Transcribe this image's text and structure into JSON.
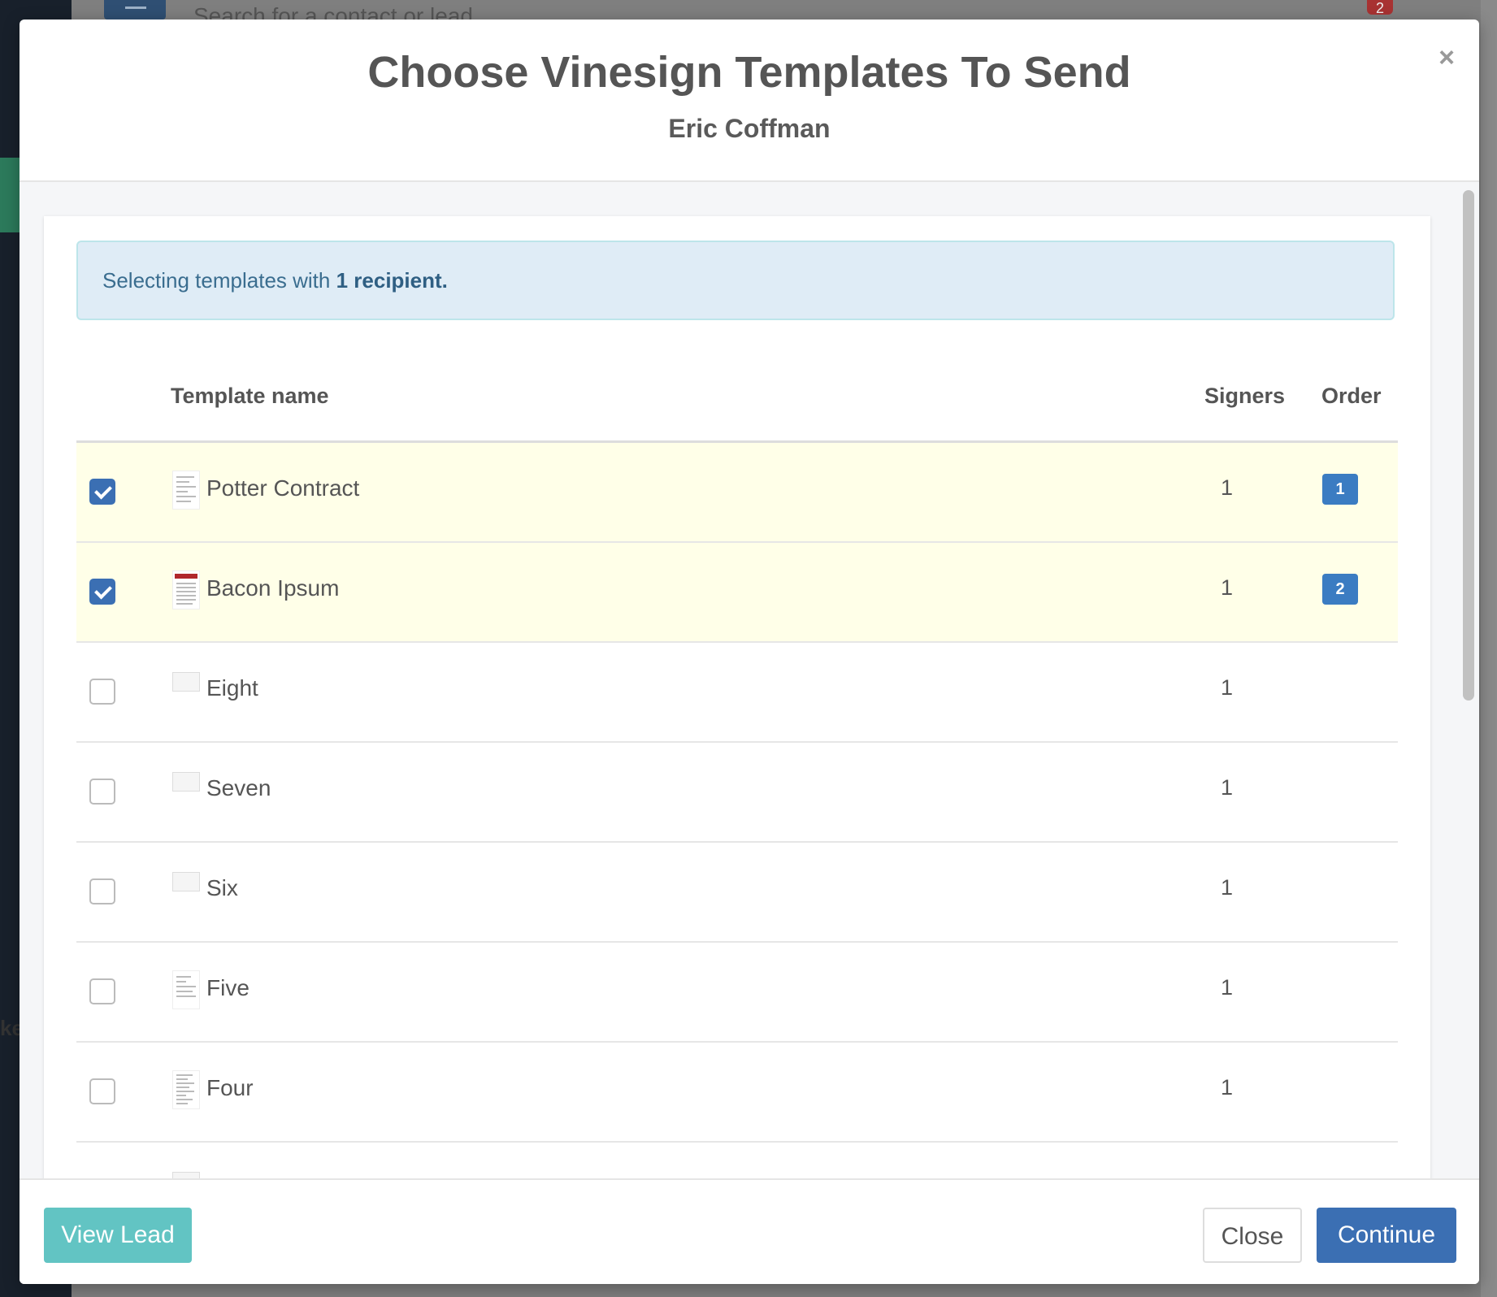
{
  "background": {
    "search_placeholder": "Search for a contact or lead",
    "notification_count": "2",
    "side_text": "ke"
  },
  "modal": {
    "title": "Choose Vinesign Templates To Send",
    "subtitle": "Eric Coffman",
    "close_icon": "×",
    "alert": {
      "prefix": "Selecting templates with ",
      "highlight": "1 recipient."
    },
    "table": {
      "headers": {
        "name": "Template name",
        "signers": "Signers",
        "order": "Order"
      },
      "rows": [
        {
          "name": "Potter Contract",
          "signers": "1",
          "checked": true,
          "order": "1"
        },
        {
          "name": "Bacon Ipsum",
          "signers": "1",
          "checked": true,
          "order": "2"
        },
        {
          "name": "Eight",
          "signers": "1",
          "checked": false,
          "order": ""
        },
        {
          "name": "Seven",
          "signers": "1",
          "checked": false,
          "order": ""
        },
        {
          "name": "Six",
          "signers": "1",
          "checked": false,
          "order": ""
        },
        {
          "name": "Five",
          "signers": "1",
          "checked": false,
          "order": ""
        },
        {
          "name": "Four",
          "signers": "1",
          "checked": false,
          "order": ""
        }
      ]
    },
    "footer": {
      "view_lead": "View Lead",
      "close": "Close",
      "continue": "Continue"
    }
  },
  "colors": {
    "primary": "#3b6fb3",
    "teal": "#62c4c3",
    "selected_row": "#ffffe8",
    "alert_bg": "#dfecf6"
  }
}
